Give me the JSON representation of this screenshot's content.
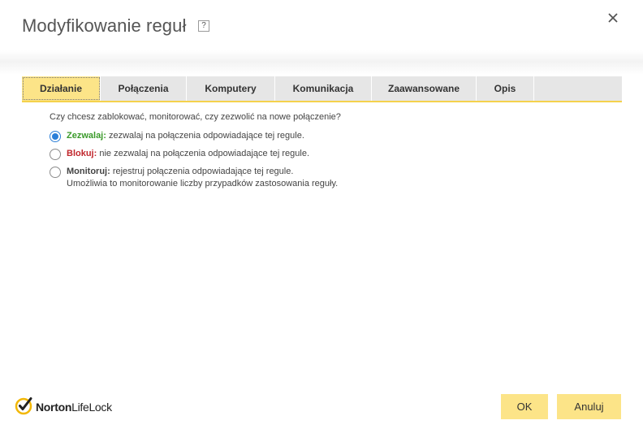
{
  "dialog": {
    "title": "Modyfikowanie reguł",
    "help_label": "?"
  },
  "tabs": [
    {
      "label": "Działanie",
      "active": true
    },
    {
      "label": "Połączenia",
      "active": false
    },
    {
      "label": "Komputery",
      "active": false
    },
    {
      "label": "Komunikacja",
      "active": false
    },
    {
      "label": "Zaawansowane",
      "active": false
    },
    {
      "label": "Opis",
      "active": false
    }
  ],
  "action": {
    "question": "Czy chcesz zablokować, monitorować, czy zezwolić na nowe połączenie?",
    "options": [
      {
        "title": "Zezwalaj:",
        "description": "zezwalaj na połączenia odpowiadające tej regule.",
        "checked": true
      },
      {
        "title": "Blokuj:",
        "description": "nie zezwalaj na połączenia odpowiadające tej regule.",
        "checked": false
      },
      {
        "title": "Monitoruj:",
        "description": "rejestruj połączenia odpowiadające tej regule.",
        "description2": "Umożliwia to monitorowanie liczby przypadków zastosowania reguły.",
        "checked": false
      }
    ]
  },
  "footer": {
    "logo_part1": "Norton",
    "logo_part2": "LifeLock",
    "ok_label": "OK",
    "cancel_label": "Anuluj"
  },
  "colors": {
    "accent_yellow": "#fce488",
    "tab_underline": "#f5d24c",
    "allow_green": "#3a9a2a",
    "block_red": "#c1272d",
    "radio_blue": "#2b7fd8"
  },
  "icons": [
    "help-icon",
    "close-icon",
    "norton-checkmark-icon"
  ]
}
